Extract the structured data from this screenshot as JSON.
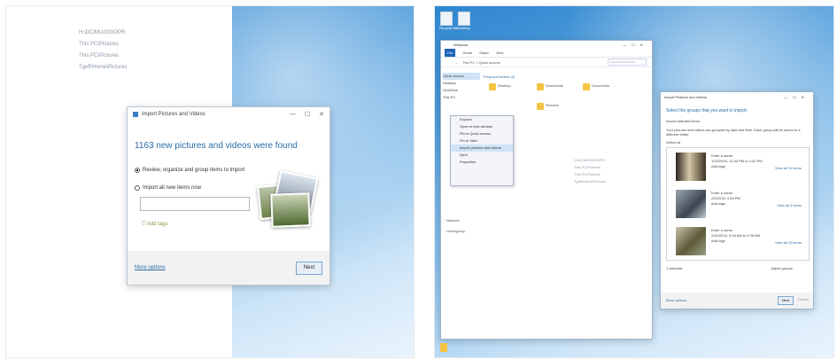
{
  "left": {
    "paths": [
      "H:\\DCIM\\100GOPR",
      "This PC\\Pictures",
      "This PC\\Pictures",
      "Tgeff\\Home\\Pictures"
    ],
    "dialog": {
      "title": "Import Pictures and Videos",
      "found": "1163 new pictures and videos were found",
      "option_review": "Review, organize and group items to import",
      "option_all": "Import all new items now",
      "add_tags": "Add tags",
      "more_options": "More options",
      "next": "Next"
    }
  },
  "right": {
    "desktop_icons": [
      "Recycle Bin",
      "Desktop"
    ],
    "explorer": {
      "title": "Windows",
      "tabs": [
        "File",
        "Home",
        "Share",
        "View"
      ],
      "address": "This PC > Quick access",
      "search_placeholder": "Search Quick access",
      "nav": [
        "Quick access",
        "Desktop",
        "OneDrive",
        "This PC",
        "Network",
        "Homegroup"
      ],
      "section_label": "Frequent folders (4)",
      "folders": [
        "Desktop",
        "Downloads",
        "Documents",
        "Pictures"
      ],
      "context_menu": [
        "Expand",
        "Open in new window",
        "Pin to Quick access",
        "Pin to Start",
        "Import pictures and videos",
        "Eject",
        "Properties"
      ],
      "locations": [
        "H:\\DCIM\\100GOPR",
        "This PC\\Pictures",
        "This PC\\Pictures",
        "Tgeff\\Home\\Pictures"
      ]
    },
    "import_dialog": {
      "title": "Import Pictures and Videos",
      "heading": "Select the groups that you want to import",
      "sub1": "Import selected items",
      "sub2": "Your pictures and videos are grouped by date and time. Each group will be saved to a different folder.",
      "select_all": "Select all",
      "groups": [
        {
          "name": "Enter a name",
          "date": "1/15/2016, 12:40 PM to 1:40 PM",
          "tags": "Add tags",
          "link": "View all 12 items"
        },
        {
          "name": "Enter a name",
          "date": "2/2/2016, 4:33 PM",
          "tags": "Add tags",
          "link": "View all 9 items"
        },
        {
          "name": "Enter a name",
          "date": "2/20/2016, 9:18 AM to 9:26 AM",
          "tags": "Add tags",
          "link": "View all 20 items"
        }
      ],
      "status_left": "1 selected",
      "status_right": "Adjust groups",
      "more_options": "More options",
      "next": "Next",
      "cancel": "Cancel"
    }
  }
}
